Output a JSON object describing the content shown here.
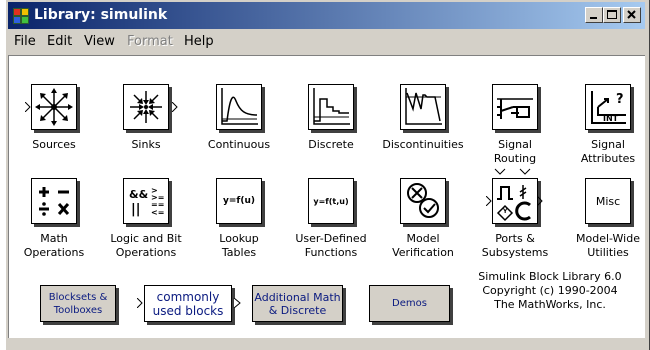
{
  "window": {
    "title": "Library: simulink"
  },
  "menu": [
    {
      "label": "File",
      "enabled": true
    },
    {
      "label": "Edit",
      "enabled": true
    },
    {
      "label": "View",
      "enabled": true
    },
    {
      "label": "Format",
      "enabled": false
    },
    {
      "label": "Help",
      "enabled": true
    }
  ],
  "blocks": {
    "sources": {
      "label": "Sources"
    },
    "sinks": {
      "label": "Sinks"
    },
    "continuous": {
      "label": "Continuous"
    },
    "discrete": {
      "label": "Discrete"
    },
    "discontinuities": {
      "label": "Discontinuities"
    },
    "signal_routing": {
      "label": "Signal\nRouting"
    },
    "signal_attributes": {
      "label": "Signal\nAttributes",
      "icon_text_top": "?",
      "icon_text_bottom": "INT"
    },
    "math_operations": {
      "label": "Math\nOperations"
    },
    "logic_bit": {
      "label": "Logic and Bit\nOperations"
    },
    "lookup_tables": {
      "label": "Lookup\nTables",
      "icon_text": "y=f(u)"
    },
    "user_defined": {
      "label": "User-Defined\nFunctions",
      "icon_text": "y=f(t,u)"
    },
    "model_verification": {
      "label": "Model\nVerification"
    },
    "ports_subsystems": {
      "label": "Ports &\nSubsystems"
    },
    "model_wide": {
      "label": "Model-Wide\nUtilities",
      "icon_text": "Misc"
    }
  },
  "buttons": {
    "blocksets": "Blocksets &\nToolboxes",
    "commonly_used": "commonly\nused blocks",
    "additional_math": "Additional Math\n& Discrete",
    "demos": "Demos"
  },
  "copyright": {
    "line1": "Simulink Block Library 6.0",
    "line2": "Copyright (c) 1990-2004",
    "line3": "The MathWorks, Inc."
  }
}
